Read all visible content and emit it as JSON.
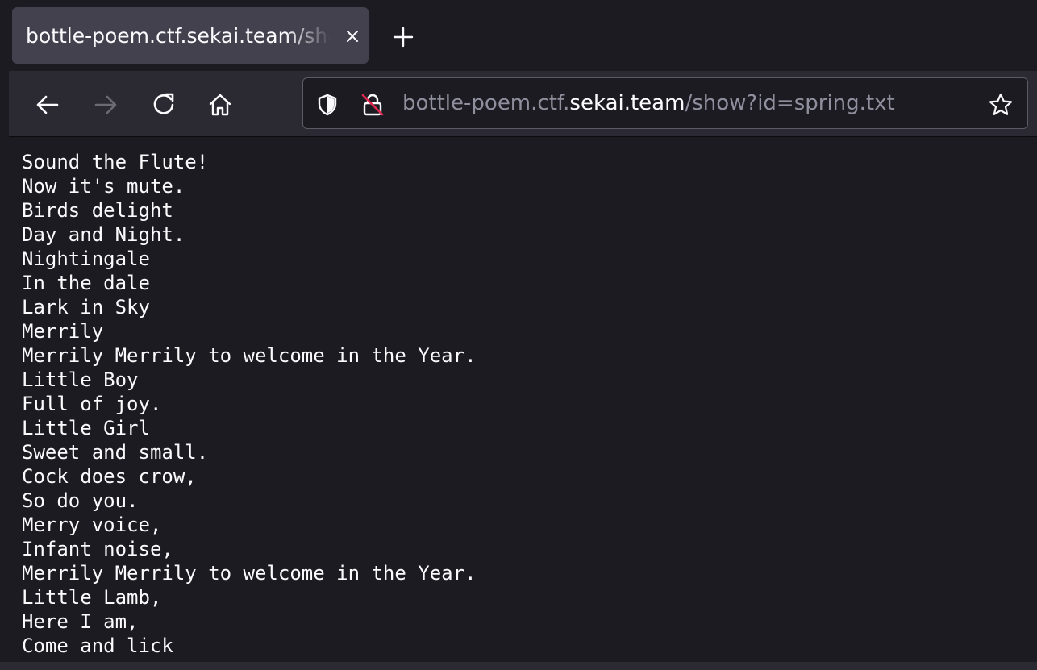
{
  "tab": {
    "title": "bottle-poem.ctf.sekai.team/show?id=spring.txt",
    "close_icon": "close-icon"
  },
  "new_tab_icon": "plus-icon",
  "nav": {
    "back_icon": "arrow-left-icon",
    "forward_icon": "arrow-right-icon",
    "reload_icon": "reload-icon",
    "home_icon": "home-icon"
  },
  "url": {
    "prefix": "bottle-poem.ctf.",
    "domain": "sekai.team",
    "path": "/show?id=spring.txt",
    "shield_icon": "shield-icon",
    "insecure_lock_icon": "insecure-lock-icon",
    "bookmark_icon": "star-icon"
  },
  "poem": {
    "lines": [
      "Sound the Flute!",
      "Now it's mute.",
      "Birds delight",
      "Day and Night.",
      "Nightingale",
      "In the dale",
      "Lark in Sky",
      "Merrily",
      "Merrily Merrily to welcome in the Year.",
      "Little Boy",
      "Full of joy.",
      "Little Girl",
      "Sweet and small.",
      "Cock does crow,",
      "So do you.",
      "Merry voice,",
      "Infant noise,",
      "Merrily Merrily to welcome in the Year.",
      "Little Lamb,",
      "Here I am,",
      "Come and lick"
    ]
  },
  "colors": {
    "background": "#1c1b22",
    "toolbar": "#2b2a33",
    "tab_active": "#42414d",
    "text": "#fbfbfe",
    "text_dim": "#8f8f9d",
    "insecure": "#e22850"
  }
}
